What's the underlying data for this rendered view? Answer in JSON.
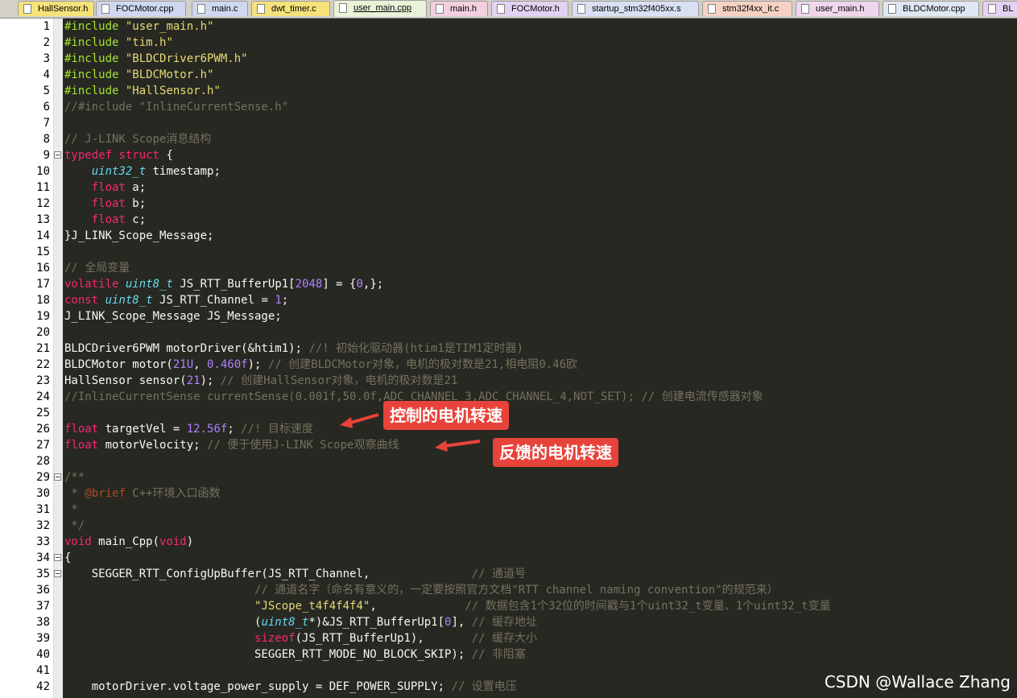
{
  "tabs": [
    {
      "label": "HallSensor.h",
      "color": "#f5e27a"
    },
    {
      "label": "FOCMotor.cpp",
      "color": "#cfd8f0"
    },
    {
      "label": "main.c",
      "color": "#cfd8f0"
    },
    {
      "label": "dwt_timer.c",
      "color": "#f5e27a"
    },
    {
      "label": "user_main.cpp",
      "color": "#eaf3da",
      "active": true
    },
    {
      "label": "main.h",
      "color": "#f3cfe0"
    },
    {
      "label": "FOCMotor.h",
      "color": "#e3d2f2"
    },
    {
      "label": "startup_stm32f405xx.s",
      "color": "#d8e0f2"
    },
    {
      "label": "stm32f4xx_it.c",
      "color": "#f6d2c4"
    },
    {
      "label": "user_main.h",
      "color": "#efd6ec"
    },
    {
      "label": "BLDCMotor.cpp",
      "color": "#dfe7f2"
    },
    {
      "label": "BL",
      "color": "#e3d2f2"
    }
  ],
  "lines": [
    {
      "n": "1",
      "t": [
        [
          "pp",
          "#include"
        ],
        [
          "str",
          " \"user_main.h\""
        ]
      ]
    },
    {
      "n": "2",
      "t": [
        [
          "pp",
          "#include"
        ],
        [
          "str",
          " \"tim.h\""
        ]
      ]
    },
    {
      "n": "3",
      "t": [
        [
          "pp",
          "#include"
        ],
        [
          "str",
          " \"BLDCDriver6PWM.h\""
        ]
      ]
    },
    {
      "n": "4",
      "t": [
        [
          "pp",
          "#include"
        ],
        [
          "str",
          " \"BLDCMotor.h\""
        ]
      ]
    },
    {
      "n": "5",
      "t": [
        [
          "pp",
          "#include"
        ],
        [
          "str",
          " \"HallSensor.h\""
        ]
      ]
    },
    {
      "n": "6",
      "t": [
        [
          "cm",
          "//#include \"InlineCurrentSense.h\""
        ]
      ]
    },
    {
      "n": "7",
      "t": []
    },
    {
      "n": "8",
      "t": [
        [
          "cm",
          "// J-LINK Scope消息结构"
        ]
      ]
    },
    {
      "n": "9",
      "t": [
        [
          "kw",
          "typedef struct"
        ],
        [
          "pl",
          " {"
        ]
      ],
      "fold": true
    },
    {
      "n": "10",
      "t": [
        [
          "pl",
          "    "
        ],
        [
          "ty",
          "uint32_t"
        ],
        [
          "pl",
          " timestamp;"
        ]
      ]
    },
    {
      "n": "11",
      "t": [
        [
          "pl",
          "    "
        ],
        [
          "kw",
          "float"
        ],
        [
          "pl",
          " a;"
        ]
      ]
    },
    {
      "n": "12",
      "t": [
        [
          "pl",
          "    "
        ],
        [
          "kw",
          "float"
        ],
        [
          "pl",
          " b;"
        ]
      ]
    },
    {
      "n": "13",
      "t": [
        [
          "pl",
          "    "
        ],
        [
          "kw",
          "float"
        ],
        [
          "pl",
          " c;"
        ]
      ]
    },
    {
      "n": "14",
      "t": [
        [
          "pl",
          "}J_LINK_Scope_Message;"
        ]
      ]
    },
    {
      "n": "15",
      "t": []
    },
    {
      "n": "16",
      "t": [
        [
          "cm",
          "// 全局变量"
        ]
      ]
    },
    {
      "n": "17",
      "t": [
        [
          "kw",
          "volatile"
        ],
        [
          "pl",
          " "
        ],
        [
          "ty",
          "uint8_t"
        ],
        [
          "pl",
          " JS_RTT_BufferUp1["
        ],
        [
          "num",
          "2048"
        ],
        [
          "pl",
          "] = {"
        ],
        [
          "num",
          "0"
        ],
        [
          "pl",
          ",};"
        ]
      ]
    },
    {
      "n": "18",
      "t": [
        [
          "kw",
          "const"
        ],
        [
          "pl",
          " "
        ],
        [
          "ty",
          "uint8_t"
        ],
        [
          "pl",
          " JS_RTT_Channel = "
        ],
        [
          "num",
          "1"
        ],
        [
          "pl",
          ";"
        ]
      ]
    },
    {
      "n": "19",
      "t": [
        [
          "pl",
          "J_LINK_Scope_Message JS_Message;"
        ]
      ]
    },
    {
      "n": "20",
      "t": []
    },
    {
      "n": "21",
      "t": [
        [
          "pl",
          "BLDCDriver6PWM motorDriver(&htim1); "
        ],
        [
          "cm",
          "//! 初始化驱动器(htim1是TIM1定时器)"
        ]
      ]
    },
    {
      "n": "22",
      "t": [
        [
          "pl",
          "BLDCMotor motor("
        ],
        [
          "num",
          "21U"
        ],
        [
          "pl",
          ", "
        ],
        [
          "num",
          "0.460f"
        ],
        [
          "pl",
          "); "
        ],
        [
          "cm",
          "// 创建BLDCMotor对象，电机的极对数是21,相电阻0.46欧"
        ]
      ]
    },
    {
      "n": "23",
      "t": [
        [
          "pl",
          "HallSensor sensor("
        ],
        [
          "num",
          "21"
        ],
        [
          "pl",
          "); "
        ],
        [
          "cm",
          "// 创建HallSensor对象，电机的极对数是21"
        ]
      ]
    },
    {
      "n": "24",
      "t": [
        [
          "cm",
          "//InlineCurrentSense currentSense(0.001f,50.0f,ADC_CHANNEL_3,ADC_CHANNEL_4,NOT_SET); // 创建电流传感器对象"
        ]
      ]
    },
    {
      "n": "25",
      "t": []
    },
    {
      "n": "26",
      "t": [
        [
          "kw",
          "float"
        ],
        [
          "pl",
          " targetVel = "
        ],
        [
          "num",
          "12.56f"
        ],
        [
          "pl",
          "; "
        ],
        [
          "cm",
          "//! 目标速度"
        ]
      ]
    },
    {
      "n": "27",
      "t": [
        [
          "kw",
          "float"
        ],
        [
          "pl",
          " motorVelocity; "
        ],
        [
          "cm",
          "// 便于使用J-LINK Scope观察曲线"
        ]
      ]
    },
    {
      "n": "28",
      "t": []
    },
    {
      "n": "29",
      "t": [
        [
          "cm",
          "/**"
        ]
      ],
      "fold": true
    },
    {
      "n": "30",
      "t": [
        [
          "cm",
          " * "
        ],
        [
          "tag",
          "@brief"
        ],
        [
          "cm",
          " C++环境入口函数"
        ]
      ]
    },
    {
      "n": "31",
      "t": [
        [
          "cm",
          " *"
        ]
      ]
    },
    {
      "n": "32",
      "t": [
        [
          "cm",
          " */"
        ]
      ]
    },
    {
      "n": "33",
      "t": [
        [
          "kw",
          "void"
        ],
        [
          "pl",
          " main_Cpp("
        ],
        [
          "kw",
          "void"
        ],
        [
          "pl",
          ")"
        ]
      ]
    },
    {
      "n": "34",
      "t": [
        [
          "pl",
          "{"
        ]
      ],
      "fold": true
    },
    {
      "n": "35",
      "t": [
        [
          "pl",
          "    SEGGER_RTT_ConfigUpBuffer(JS_RTT_Channel,               "
        ],
        [
          "cm",
          "// 通道号"
        ]
      ],
      "fold": true
    },
    {
      "n": "36",
      "t": [
        [
          "pl",
          "                            "
        ],
        [
          "cm",
          "// 通道名字（命名有意义的，一定要按照官方文档\"RTT channel naming convention\"的规范来）"
        ]
      ]
    },
    {
      "n": "37",
      "t": [
        [
          "pl",
          "                            "
        ],
        [
          "str",
          "\"JScope_t4f4f4f4\""
        ],
        [
          "pl",
          ",             "
        ],
        [
          "cm",
          "// 数据包含1个32位的时间戳与1个uint32_t变量、1个uint32_t变量"
        ]
      ]
    },
    {
      "n": "38",
      "t": [
        [
          "pl",
          "                            ("
        ],
        [
          "ty",
          "uint8_t"
        ],
        [
          "pl",
          "*)&JS_RTT_BufferUp1["
        ],
        [
          "num",
          "0"
        ],
        [
          "pl",
          "], "
        ],
        [
          "cm",
          "// 缓存地址"
        ]
      ]
    },
    {
      "n": "39",
      "t": [
        [
          "pl",
          "                            "
        ],
        [
          "kw",
          "sizeof"
        ],
        [
          "pl",
          "(JS_RTT_BufferUp1),       "
        ],
        [
          "cm",
          "// 缓存大小"
        ]
      ]
    },
    {
      "n": "40",
      "t": [
        [
          "pl",
          "                            SEGGER_RTT_MODE_NO_BLOCK_SKIP); "
        ],
        [
          "cm",
          "// 非阻塞"
        ]
      ]
    },
    {
      "n": "41",
      "t": []
    },
    {
      "n": "42",
      "t": [
        [
          "pl",
          "    motorDriver.voltage_power_supply = DEF_POWER_SUPPLY; "
        ],
        [
          "cm",
          "// 设置电压"
        ]
      ]
    }
  ],
  "annotations": {
    "control": "控制的电机转速",
    "feedback": "反馈的电机转速"
  },
  "watermark": "CSDN @Wallace Zhang",
  "colors": {
    "callout": "#e8433a",
    "background": "#272822"
  }
}
